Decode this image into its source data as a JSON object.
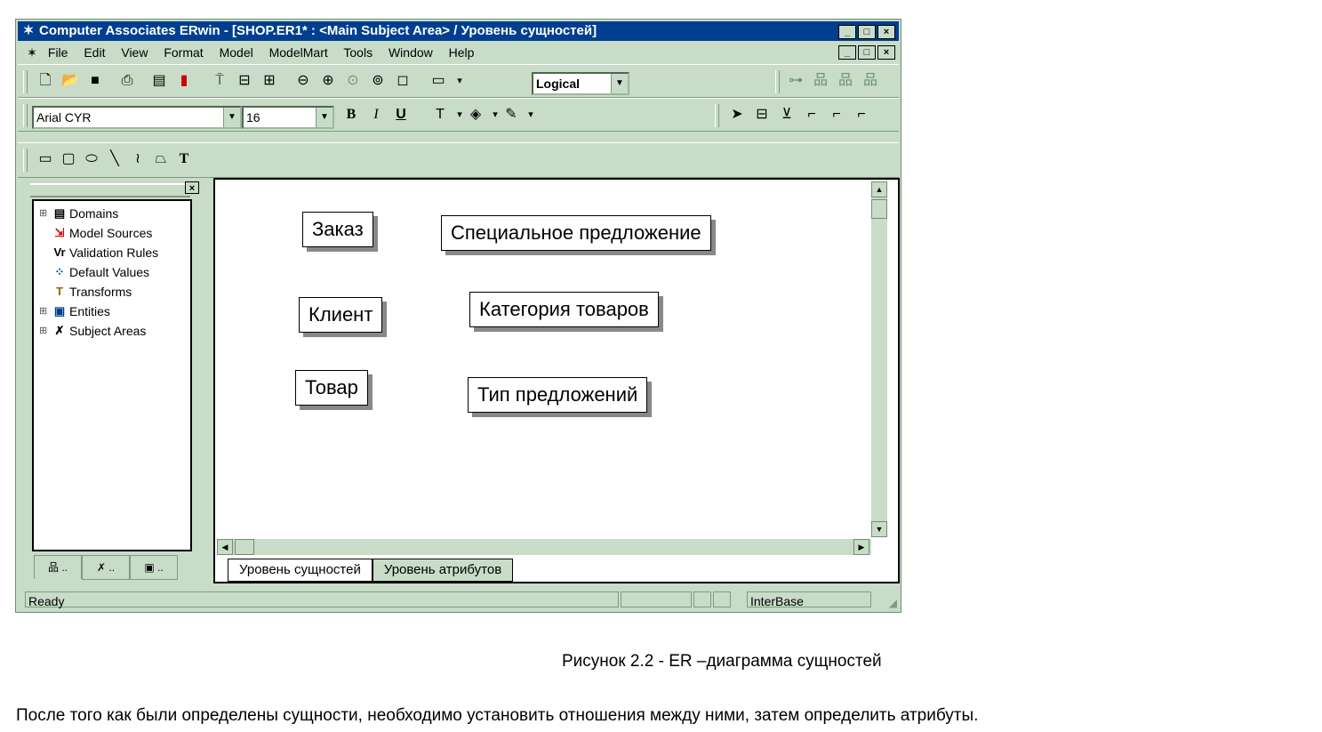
{
  "window": {
    "title": "Computer Associates ERwin - [SHOP.ER1* : <Main Subject Area> / Уровень сущностей]",
    "controls": [
      "_",
      "□",
      "×"
    ]
  },
  "menu": [
    "File",
    "Edit",
    "View",
    "Format",
    "Model",
    "ModelMart",
    "Tools",
    "Window",
    "Help"
  ],
  "toolbar": {
    "display_level": "Logical",
    "font_name": "Arial CYR",
    "font_size": "16"
  },
  "model_explorer": {
    "items": [
      {
        "label": "Domains",
        "expandable": true,
        "icon": "domains-icon"
      },
      {
        "label": "Model Sources",
        "expandable": false,
        "icon": "model-sources-icon"
      },
      {
        "label": "Validation Rules",
        "expandable": false,
        "icon": "validation-rules-icon"
      },
      {
        "label": "Default Values",
        "expandable": false,
        "icon": "default-values-icon"
      },
      {
        "label": "Transforms",
        "expandable": false,
        "icon": "transforms-icon"
      },
      {
        "label": "Entities",
        "expandable": true,
        "icon": "entities-icon"
      },
      {
        "label": "Subject Areas",
        "expandable": true,
        "icon": "subject-areas-icon"
      }
    ],
    "tabs": [
      "..",
      "..",
      ".."
    ]
  },
  "diagram": {
    "entities": [
      {
        "name": "Заказ"
      },
      {
        "name": "Специальное предложение"
      },
      {
        "name": "Клиент"
      },
      {
        "name": "Категория товаров"
      },
      {
        "name": "Товар"
      },
      {
        "name": "Тип предложений"
      }
    ],
    "sheet_tabs": [
      "Уровень сущностей",
      "Уровень атрибутов"
    ]
  },
  "status": {
    "text": "Ready",
    "database": "InterBase"
  },
  "caption": "Рисунок 2.2 - ER –диаграмма сущностей",
  "paragraph": "После того как были определены сущности, необходимо установить отношения между ними, затем определить атрибуты."
}
